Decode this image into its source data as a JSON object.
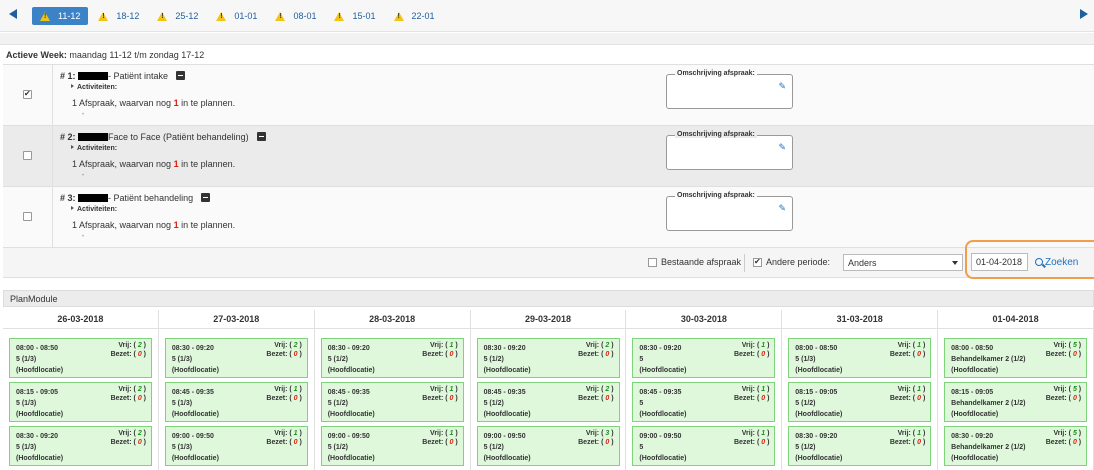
{
  "weeks": [
    {
      "label": "11-12",
      "active": true
    },
    {
      "label": "18-12",
      "active": false
    },
    {
      "label": "25-12",
      "active": false
    },
    {
      "label": "01-01",
      "active": false
    },
    {
      "label": "08-01",
      "active": false
    },
    {
      "label": "15-01",
      "active": false
    },
    {
      "label": "22-01",
      "active": false
    }
  ],
  "active_week": {
    "label": "Actieve Week:",
    "value": "maandag 11-12 t/m zondag 17-12"
  },
  "rows": [
    {
      "num": "# 1:",
      "title": "- Patiënt intake",
      "activities": "Activiteiten:",
      "count_pre": "1 Afspraak, waarvan nog ",
      "count_n": "1",
      "count_post": " in te plannen.",
      "desc_label": "Omschrijving afspraak:",
      "checked": true
    },
    {
      "num": "# 2:",
      "title": "Face to Face (Patiënt behandeling)",
      "activities": "Activiteiten:",
      "count_pre": "1 Afspraak, waarvan nog ",
      "count_n": "1",
      "count_post": " in te plannen.",
      "desc_label": "Omschrijving afspraak:",
      "checked": false
    },
    {
      "num": "# 3:",
      "title": "- Patiënt behandeling",
      "activities": "Activiteiten:",
      "count_pre": "1 Afspraak, waarvan nog ",
      "count_n": "1",
      "count_post": " in te plannen.",
      "desc_label": "Omschrijving afspraak:",
      "checked": false
    }
  ],
  "filters": {
    "existing_label": "Bestaande afspraak",
    "existing_checked": false,
    "other_period_label": "Andere periode:",
    "other_period_checked": true,
    "period_select": "Anders",
    "date_value": "01-04-2018",
    "search_label": "Zoeken"
  },
  "plan_module": {
    "title": "PlanModule",
    "free_label": "Vrij:",
    "busy_label": "Bezet:",
    "days": [
      {
        "date": "26-03-2018",
        "slots": [
          {
            "time": "08:00 - 08:50",
            "room": "5 (1/3)",
            "loc": "(Hoofdlocatie)",
            "free": "2",
            "busy": "0"
          },
          {
            "time": "08:15 - 09:05",
            "room": "5 (1/3)",
            "loc": "(Hoofdlocatie)",
            "free": "2",
            "busy": "0"
          },
          {
            "time": "08:30 - 09:20",
            "room": "5 (1/3)",
            "loc": "(Hoofdlocatie)",
            "free": "2",
            "busy": "0"
          }
        ]
      },
      {
        "date": "27-03-2018",
        "slots": [
          {
            "time": "08:30 - 09:20",
            "room": "5 (1/3)",
            "loc": "(Hoofdlocatie)",
            "free": "2",
            "busy": "0"
          },
          {
            "time": "08:45 - 09:35",
            "room": "5 (1/3)",
            "loc": "(Hoofdlocatie)",
            "free": "1",
            "busy": "0"
          },
          {
            "time": "09:00 - 09:50",
            "room": "5 (1/3)",
            "loc": "(Hoofdlocatie)",
            "free": "1",
            "busy": "0"
          }
        ]
      },
      {
        "date": "28-03-2018",
        "slots": [
          {
            "time": "08:30 - 09:20",
            "room": "5 (1/2)",
            "loc": "(Hoofdlocatie)",
            "free": "1",
            "busy": "0"
          },
          {
            "time": "08:45 - 09:35",
            "room": "5 (1/2)",
            "loc": "(Hoofdlocatie)",
            "free": "1",
            "busy": "0"
          },
          {
            "time": "09:00 - 09:50",
            "room": "5 (1/2)",
            "loc": "(Hoofdlocatie)",
            "free": "1",
            "busy": "0"
          }
        ]
      },
      {
        "date": "29-03-2018",
        "slots": [
          {
            "time": "08:30 - 09:20",
            "room": "5 (1/2)",
            "loc": "(Hoofdlocatie)",
            "free": "2",
            "busy": "0"
          },
          {
            "time": "08:45 - 09:35",
            "room": "5 (1/2)",
            "loc": "(Hoofdlocatie)",
            "free": "2",
            "busy": "0"
          },
          {
            "time": "09:00 - 09:50",
            "room": "5 (1/2)",
            "loc": "(Hoofdlocatie)",
            "free": "3",
            "busy": "0"
          }
        ]
      },
      {
        "date": "30-03-2018",
        "slots": [
          {
            "time": "08:30 - 09:20",
            "room": "5",
            "loc": "(Hoofdlocatie)",
            "free": "1",
            "busy": "0"
          },
          {
            "time": "08:45 - 09:35",
            "room": "5",
            "loc": "(Hoofdlocatie)",
            "free": "1",
            "busy": "0"
          },
          {
            "time": "09:00 - 09:50",
            "room": "5",
            "loc": "(Hoofdlocatie)",
            "free": "1",
            "busy": "0"
          }
        ]
      },
      {
        "date": "31-03-2018",
        "slots": [
          {
            "time": "08:00 - 08:50",
            "room": "5 (1/3)",
            "loc": "(Hoofdlocatie)",
            "free": "1",
            "busy": "0"
          },
          {
            "time": "08:15 - 09:05",
            "room": "5 (1/2)",
            "loc": "(Hoofdlocatie)",
            "free": "1",
            "busy": "0"
          },
          {
            "time": "08:30 - 09:20",
            "room": "5 (1/2)",
            "loc": "(Hoofdlocatie)",
            "free": "1",
            "busy": "0"
          }
        ]
      },
      {
        "date": "01-04-2018",
        "slots": [
          {
            "time": "08:00 - 08:50",
            "room": "Behandelkamer 2 (1/2)",
            "loc": "(Hoofdlocatie)",
            "free": "5",
            "busy": "0"
          },
          {
            "time": "08:15 - 09:05",
            "room": "Behandelkamer 2 (1/2)",
            "loc": "(Hoofdlocatie)",
            "free": "5",
            "busy": "0"
          },
          {
            "time": "08:30 - 09:20",
            "room": "Behandelkamer 2 (1/2)",
            "loc": "(Hoofdlocatie)",
            "free": "5",
            "busy": "0"
          }
        ]
      }
    ]
  }
}
